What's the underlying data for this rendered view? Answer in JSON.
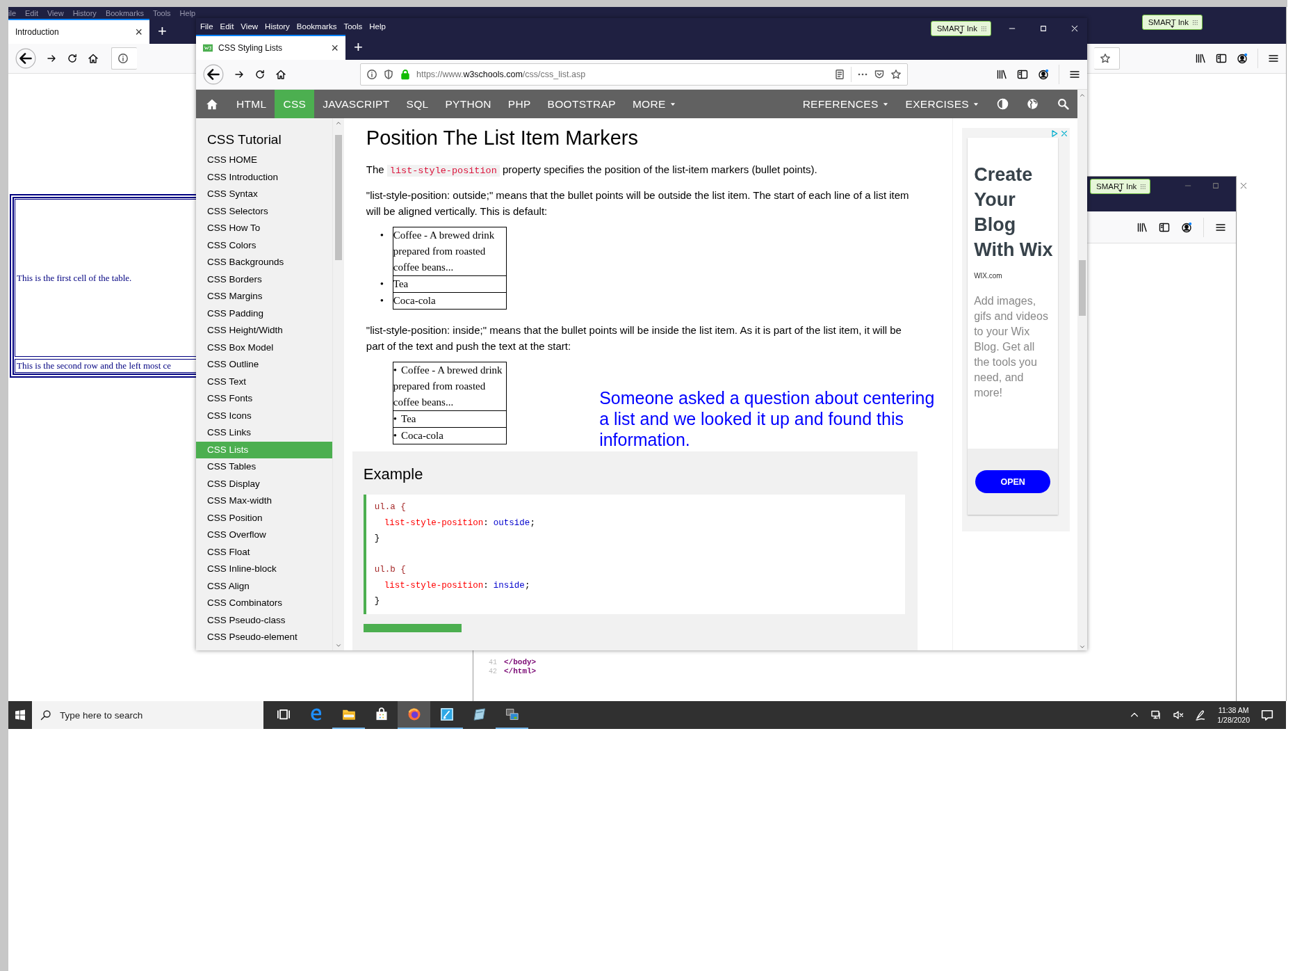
{
  "back_window": {
    "menu": [
      "ile",
      "Edit",
      "View",
      "History",
      "Bookmarks",
      "Tools",
      "Help"
    ],
    "smart_ink": "SMART Ink",
    "tab": {
      "title": "Introduction",
      "close": "×"
    },
    "new_tab": "+",
    "table": [
      "This is the first cell of the table.",
      "This is the second row and the left most ce"
    ]
  },
  "editor_window": {
    "smart_ink": "SMART Ink",
    "lines": [
      {
        "number": "41",
        "code": "</body>"
      },
      {
        "number": "42",
        "code": "</html>"
      }
    ]
  },
  "main_window": {
    "menu": [
      "File",
      "Edit",
      "View",
      "History",
      "Bookmarks",
      "Tools",
      "Help"
    ],
    "smart_ink": "SMART Ink",
    "tab": {
      "title": "CSS Styling Lists",
      "close": "×"
    },
    "new_tab": "+",
    "url": {
      "scheme": "https://www.",
      "domain": "w3schools.com",
      "path": "/css/css_list.asp"
    },
    "navbar": [
      {
        "label": "HTML",
        "selected": false,
        "dropdown": false
      },
      {
        "label": "CSS",
        "selected": true,
        "dropdown": false
      },
      {
        "label": "JAVASCRIPT",
        "selected": false,
        "dropdown": false
      },
      {
        "label": "SQL",
        "selected": false,
        "dropdown": false
      },
      {
        "label": "PYTHON",
        "selected": false,
        "dropdown": false
      },
      {
        "label": "PHP",
        "selected": false,
        "dropdown": false
      },
      {
        "label": "BOOTSTRAP",
        "selected": false,
        "dropdown": false
      },
      {
        "label": "MORE",
        "selected": false,
        "dropdown": true
      }
    ],
    "navbar_right": [
      {
        "label": "REFERENCES",
        "selected": false,
        "dropdown": true
      },
      {
        "label": "EXERCISES",
        "selected": false,
        "dropdown": true
      }
    ],
    "sidebar": {
      "title": "CSS Tutorial",
      "items": [
        {
          "label": "CSS HOME",
          "selected": false
        },
        {
          "label": "CSS Introduction",
          "selected": false
        },
        {
          "label": "CSS Syntax",
          "selected": false
        },
        {
          "label": "CSS Selectors",
          "selected": false
        },
        {
          "label": "CSS How To",
          "selected": false
        },
        {
          "label": "CSS Colors",
          "selected": false
        },
        {
          "label": "CSS Backgrounds",
          "selected": false
        },
        {
          "label": "CSS Borders",
          "selected": false
        },
        {
          "label": "CSS Margins",
          "selected": false
        },
        {
          "label": "CSS Padding",
          "selected": false
        },
        {
          "label": "CSS Height/Width",
          "selected": false
        },
        {
          "label": "CSS Box Model",
          "selected": false
        },
        {
          "label": "CSS Outline",
          "selected": false
        },
        {
          "label": "CSS Text",
          "selected": false
        },
        {
          "label": "CSS Fonts",
          "selected": false
        },
        {
          "label": "CSS Icons",
          "selected": false
        },
        {
          "label": "CSS Links",
          "selected": false
        },
        {
          "label": "CSS Lists",
          "selected": true
        },
        {
          "label": "CSS Tables",
          "selected": false
        },
        {
          "label": "CSS Display",
          "selected": false
        },
        {
          "label": "CSS Max-width",
          "selected": false
        },
        {
          "label": "CSS Position",
          "selected": false
        },
        {
          "label": "CSS Overflow",
          "selected": false
        },
        {
          "label": "CSS Float",
          "selected": false
        },
        {
          "label": "CSS Inline-block",
          "selected": false
        },
        {
          "label": "CSS Align",
          "selected": false
        },
        {
          "label": "CSS Combinators",
          "selected": false
        },
        {
          "label": "CSS Pseudo-class",
          "selected": false
        },
        {
          "label": "CSS Pseudo-element",
          "selected": false
        }
      ]
    },
    "article": {
      "heading": "Position The List Item Markers",
      "intro": {
        "before": "The",
        "code": "list-style-position",
        "after": "property specifies the position of the list-item markers (bullet points)."
      },
      "outside_text": "\"list-style-position: outside;\" means that the bullet points will be outside the list item. The start of each line of a list item will be aligned vertically. This is default:",
      "bullet": "•",
      "outside_list": [
        "Coffee - A brewed drink prepared from roasted coffee beans...",
        "Tea",
        "Coca-cola"
      ],
      "inside_text": "\"list-style-position: inside;\" means that the bullet points will be inside the list item. As it is part of the list item, it will be part of the text and push the text at the start:",
      "inside_list": [
        "Coffee - A brewed drink prepared from roasted coffee beans...",
        "Tea",
        "Coca-cola"
      ],
      "note": "Someone asked a question about centering a list and we looked it up and found this information.",
      "example": {
        "title": "Example",
        "code": [
          {
            "kind": "selector",
            "text": "ul.a {"
          },
          {
            "kind": "declaration",
            "property": "list-style-position",
            "colon": ":",
            "value": "outside",
            "end": ";"
          },
          {
            "kind": "plain",
            "text": "}"
          },
          {
            "kind": "blank"
          },
          {
            "kind": "selector",
            "text": "ul.b {"
          },
          {
            "kind": "declaration",
            "property": "list-style-position",
            "colon": ":",
            "value": "inside",
            "end": ";"
          },
          {
            "kind": "plain",
            "text": "}"
          }
        ]
      }
    },
    "ad": {
      "headline": "Create Your Blog With Wix",
      "source": "WIX.com",
      "body": "Add images, gifs and videos to your Wix Blog. Get all the tools you need, and more!",
      "button": "OPEN"
    }
  },
  "taskbar": {
    "search": {
      "placeholder": "Type here to search"
    },
    "apps": [
      {
        "kind": "task_view",
        "running": false,
        "selected": false
      },
      {
        "kind": "edge",
        "running": false,
        "selected": false
      },
      {
        "kind": "explorer",
        "running": true,
        "selected": false
      },
      {
        "kind": "store",
        "running": false,
        "selected": false
      },
      {
        "kind": "firefox",
        "running": true,
        "selected": true
      },
      {
        "kind": "notes",
        "running": true,
        "selected": false
      },
      {
        "kind": "card",
        "running": false,
        "selected": false
      },
      {
        "kind": "stack",
        "running": true,
        "selected": false
      }
    ],
    "clock": {
      "time": "11:38 AM",
      "date": "1/28/2020"
    }
  }
}
